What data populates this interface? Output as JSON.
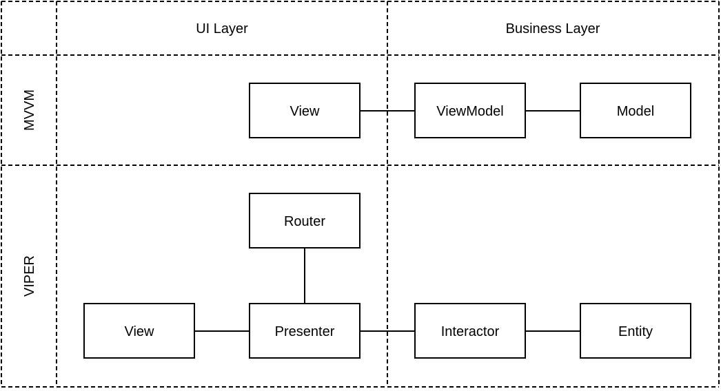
{
  "diagram": {
    "columns": [
      {
        "id": "ui",
        "label": "UI Layer"
      },
      {
        "id": "business",
        "label": "Business Layer"
      }
    ],
    "rows": [
      {
        "id": "mvvm",
        "label": "MVVM"
      },
      {
        "id": "viper",
        "label": "VIPER"
      }
    ],
    "nodes": [
      {
        "id": "mvvm-view",
        "label": "View",
        "row": "mvvm"
      },
      {
        "id": "mvvm-viewmodel",
        "label": "ViewModel",
        "row": "mvvm"
      },
      {
        "id": "mvvm-model",
        "label": "Model",
        "row": "mvvm"
      },
      {
        "id": "viper-router",
        "label": "Router",
        "row": "viper"
      },
      {
        "id": "viper-view",
        "label": "View",
        "row": "viper"
      },
      {
        "id": "viper-presenter",
        "label": "Presenter",
        "row": "viper"
      },
      {
        "id": "viper-interactor",
        "label": "Interactor",
        "row": "viper"
      },
      {
        "id": "viper-entity",
        "label": "Entity",
        "row": "viper"
      }
    ],
    "edges": [
      {
        "from": "mvvm-view",
        "to": "mvvm-viewmodel"
      },
      {
        "from": "mvvm-viewmodel",
        "to": "mvvm-model"
      },
      {
        "from": "viper-router",
        "to": "viper-presenter"
      },
      {
        "from": "viper-view",
        "to": "viper-presenter"
      },
      {
        "from": "viper-presenter",
        "to": "viper-interactor"
      },
      {
        "from": "viper-interactor",
        "to": "viper-entity"
      }
    ]
  }
}
